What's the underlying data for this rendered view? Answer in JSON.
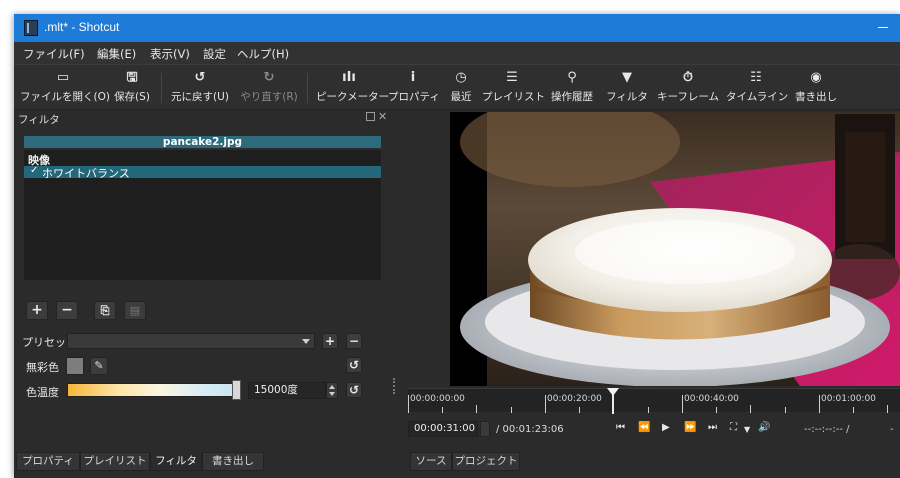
{
  "window": {
    "title": ".mlt* - Shotcut"
  },
  "menu": [
    "ファイル(F)",
    "編集(E)",
    "表示(V)",
    "設定",
    "ヘルプ(H)"
  ],
  "toolbar": [
    {
      "icon": "folder-open-icon",
      "glyph": "▭",
      "label": "ファイルを開く(O)",
      "enabled": true
    },
    {
      "icon": "save-icon",
      "glyph": "🖫",
      "label": "保存(S)",
      "enabled": true
    },
    {
      "icon": "undo-icon",
      "glyph": "↺",
      "label": "元に戻す(U)",
      "enabled": true
    },
    {
      "icon": "redo-icon",
      "glyph": "↻",
      "label": "やり直す(R)",
      "enabled": false
    },
    {
      "icon": "peak-meter-icon",
      "glyph": "ıIı",
      "label": "ピークメーター",
      "enabled": true
    },
    {
      "icon": "info-icon",
      "glyph": "i",
      "label": "プロパティ",
      "enabled": true
    },
    {
      "icon": "clock-icon",
      "glyph": "◷",
      "label": "最近",
      "enabled": true
    },
    {
      "icon": "list-icon",
      "glyph": "☰",
      "label": "プレイリスト",
      "enabled": true
    },
    {
      "icon": "history-icon",
      "glyph": "⚲",
      "label": "操作履歴",
      "enabled": true
    },
    {
      "icon": "funnel-icon",
      "glyph": "▼",
      "label": "フィルタ",
      "enabled": true
    },
    {
      "icon": "stopwatch-icon",
      "glyph": "⏱",
      "label": "キーフレーム",
      "enabled": true
    },
    {
      "icon": "timeline-icon",
      "glyph": "☷",
      "label": "タイムライン",
      "enabled": true
    },
    {
      "icon": "export-disc-icon",
      "glyph": "◉",
      "label": "書き出し",
      "enabled": true
    }
  ],
  "filter_panel": {
    "title": "フィルタ",
    "clip_name": "pancake2.jpg",
    "category": "映像",
    "filters": [
      {
        "checked": true,
        "name": "ホワイトバランス"
      }
    ],
    "preset_label": "プリセット",
    "preset_value": "",
    "neutral_label": "無彩色",
    "neutral_color": "#7d7d7d",
    "temperature_label": "色温度",
    "temperature_value": "15000度",
    "temperature_fraction": 0.97
  },
  "left_tabs": [
    "プロパティ",
    "プレイリスト",
    "フィルタ",
    "書き出し"
  ],
  "left_active_tab": "フィルタ",
  "right_tabs": [
    "ソース",
    "プロジェクト"
  ],
  "player": {
    "ruler_labels": [
      "00:00:00:00",
      "00:00:20:00",
      "00:00:40:00",
      "00:01:00:00"
    ],
    "position": "00:00:31:00",
    "duration": "/ 00:01:23:06",
    "in_point": "--:--:--:-- /",
    "out_point": "-"
  }
}
